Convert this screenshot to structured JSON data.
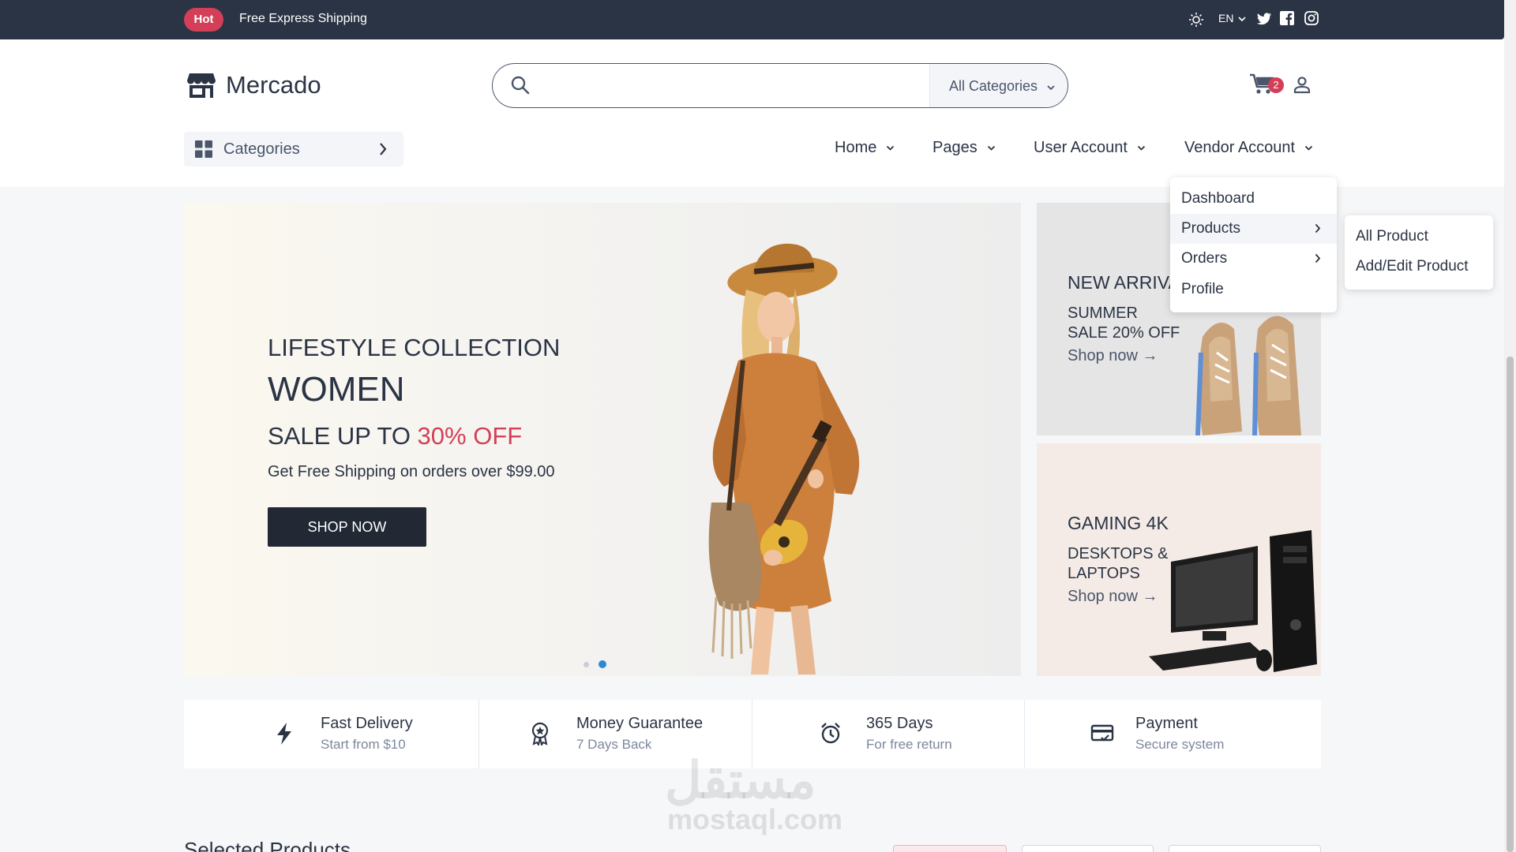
{
  "topbar": {
    "badge": "Hot",
    "message": "Free Express Shipping",
    "language": "EN",
    "icons": [
      "sun-icon",
      "twitter-icon",
      "facebook-icon",
      "instagram-icon"
    ]
  },
  "header": {
    "logo": "Mercado",
    "search": {
      "placeholder": "",
      "category": "All Categories"
    },
    "cart_count": "2"
  },
  "categories_button": "Categories",
  "nav": [
    {
      "label": "Home"
    },
    {
      "label": "Pages"
    },
    {
      "label": "User Account"
    },
    {
      "label": "Vendor Account"
    }
  ],
  "dropdown": {
    "items": [
      "Dashboard",
      "Products",
      "Orders",
      "Profile"
    ],
    "submenu": [
      "All Product",
      "Add/Edit Product"
    ]
  },
  "hero": {
    "subtitle": "LIFESTYLE COLLECTION",
    "title": "WOMEN",
    "sale_prefix": "SALE UP TO ",
    "sale_highlight": "30% OFF",
    "shipping": "Get Free Shipping on orders over $99.00",
    "button": "SHOP NOW",
    "slide_active": 2
  },
  "banners": [
    {
      "title": "NEW ARRIVAL",
      "line1": "SUMMER",
      "line2": "SALE 20% OFF",
      "link": "Shop now →"
    },
    {
      "title": "GAMING 4K",
      "line1": "DESKTOPS &",
      "line2": "LAPTOPS",
      "link": "Shop now →"
    }
  ],
  "services": [
    {
      "title": "Fast Delivery",
      "sub": "Start from $10",
      "icon": "lightning-icon"
    },
    {
      "title": "Money Guarantee",
      "sub": "7 Days Back",
      "icon": "badge-icon"
    },
    {
      "title": "365 Days",
      "sub": "For free return",
      "icon": "alarm-icon"
    },
    {
      "title": "Payment",
      "sub": "Secure system",
      "icon": "card-icon"
    }
  ],
  "bottom_title": "Selected Products",
  "watermark": {
    "arabic": "مستقل",
    "latin": "mostaql.com"
  },
  "colors": {
    "primary": "#d23f57",
    "dark": "#2b3445",
    "accent": "#2b8ad6"
  }
}
